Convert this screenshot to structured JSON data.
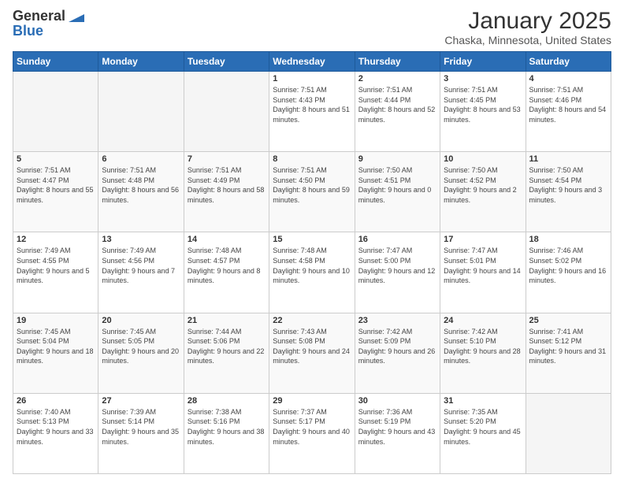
{
  "header": {
    "logo_general": "General",
    "logo_blue": "Blue",
    "title": "January 2025",
    "subtitle": "Chaska, Minnesota, United States"
  },
  "weekdays": [
    "Sunday",
    "Monday",
    "Tuesday",
    "Wednesday",
    "Thursday",
    "Friday",
    "Saturday"
  ],
  "weeks": [
    [
      {
        "day": "",
        "empty": true
      },
      {
        "day": "",
        "empty": true
      },
      {
        "day": "",
        "empty": true
      },
      {
        "day": "1",
        "sunrise": "7:51 AM",
        "sunset": "4:43 PM",
        "daylight": "8 hours and 51 minutes."
      },
      {
        "day": "2",
        "sunrise": "7:51 AM",
        "sunset": "4:44 PM",
        "daylight": "8 hours and 52 minutes."
      },
      {
        "day": "3",
        "sunrise": "7:51 AM",
        "sunset": "4:45 PM",
        "daylight": "8 hours and 53 minutes."
      },
      {
        "day": "4",
        "sunrise": "7:51 AM",
        "sunset": "4:46 PM",
        "daylight": "8 hours and 54 minutes."
      }
    ],
    [
      {
        "day": "5",
        "sunrise": "7:51 AM",
        "sunset": "4:47 PM",
        "daylight": "8 hours and 55 minutes."
      },
      {
        "day": "6",
        "sunrise": "7:51 AM",
        "sunset": "4:48 PM",
        "daylight": "8 hours and 56 minutes."
      },
      {
        "day": "7",
        "sunrise": "7:51 AM",
        "sunset": "4:49 PM",
        "daylight": "8 hours and 58 minutes."
      },
      {
        "day": "8",
        "sunrise": "7:51 AM",
        "sunset": "4:50 PM",
        "daylight": "8 hours and 59 minutes."
      },
      {
        "day": "9",
        "sunrise": "7:50 AM",
        "sunset": "4:51 PM",
        "daylight": "9 hours and 0 minutes."
      },
      {
        "day": "10",
        "sunrise": "7:50 AM",
        "sunset": "4:52 PM",
        "daylight": "9 hours and 2 minutes."
      },
      {
        "day": "11",
        "sunrise": "7:50 AM",
        "sunset": "4:54 PM",
        "daylight": "9 hours and 3 minutes."
      }
    ],
    [
      {
        "day": "12",
        "sunrise": "7:49 AM",
        "sunset": "4:55 PM",
        "daylight": "9 hours and 5 minutes."
      },
      {
        "day": "13",
        "sunrise": "7:49 AM",
        "sunset": "4:56 PM",
        "daylight": "9 hours and 7 minutes."
      },
      {
        "day": "14",
        "sunrise": "7:48 AM",
        "sunset": "4:57 PM",
        "daylight": "9 hours and 8 minutes."
      },
      {
        "day": "15",
        "sunrise": "7:48 AM",
        "sunset": "4:58 PM",
        "daylight": "9 hours and 10 minutes."
      },
      {
        "day": "16",
        "sunrise": "7:47 AM",
        "sunset": "5:00 PM",
        "daylight": "9 hours and 12 minutes."
      },
      {
        "day": "17",
        "sunrise": "7:47 AM",
        "sunset": "5:01 PM",
        "daylight": "9 hours and 14 minutes."
      },
      {
        "day": "18",
        "sunrise": "7:46 AM",
        "sunset": "5:02 PM",
        "daylight": "9 hours and 16 minutes."
      }
    ],
    [
      {
        "day": "19",
        "sunrise": "7:45 AM",
        "sunset": "5:04 PM",
        "daylight": "9 hours and 18 minutes."
      },
      {
        "day": "20",
        "sunrise": "7:45 AM",
        "sunset": "5:05 PM",
        "daylight": "9 hours and 20 minutes."
      },
      {
        "day": "21",
        "sunrise": "7:44 AM",
        "sunset": "5:06 PM",
        "daylight": "9 hours and 22 minutes."
      },
      {
        "day": "22",
        "sunrise": "7:43 AM",
        "sunset": "5:08 PM",
        "daylight": "9 hours and 24 minutes."
      },
      {
        "day": "23",
        "sunrise": "7:42 AM",
        "sunset": "5:09 PM",
        "daylight": "9 hours and 26 minutes."
      },
      {
        "day": "24",
        "sunrise": "7:42 AM",
        "sunset": "5:10 PM",
        "daylight": "9 hours and 28 minutes."
      },
      {
        "day": "25",
        "sunrise": "7:41 AM",
        "sunset": "5:12 PM",
        "daylight": "9 hours and 31 minutes."
      }
    ],
    [
      {
        "day": "26",
        "sunrise": "7:40 AM",
        "sunset": "5:13 PM",
        "daylight": "9 hours and 33 minutes."
      },
      {
        "day": "27",
        "sunrise": "7:39 AM",
        "sunset": "5:14 PM",
        "daylight": "9 hours and 35 minutes."
      },
      {
        "day": "28",
        "sunrise": "7:38 AM",
        "sunset": "5:16 PM",
        "daylight": "9 hours and 38 minutes."
      },
      {
        "day": "29",
        "sunrise": "7:37 AM",
        "sunset": "5:17 PM",
        "daylight": "9 hours and 40 minutes."
      },
      {
        "day": "30",
        "sunrise": "7:36 AM",
        "sunset": "5:19 PM",
        "daylight": "9 hours and 43 minutes."
      },
      {
        "day": "31",
        "sunrise": "7:35 AM",
        "sunset": "5:20 PM",
        "daylight": "9 hours and 45 minutes."
      },
      {
        "day": "",
        "empty": true
      }
    ]
  ]
}
